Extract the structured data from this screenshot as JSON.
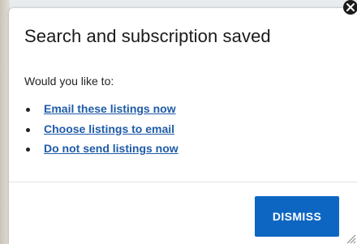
{
  "dialog": {
    "title": "Search and subscription saved",
    "prompt": "Would you like to:",
    "options": [
      {
        "label": "Email these listings now"
      },
      {
        "label": "Choose listings to email"
      },
      {
        "label": "Do not send listings now"
      }
    ],
    "dismiss_label": "DISMISS",
    "close_icon": "close-icon",
    "resize_icon": "resize-grip-icon"
  },
  "colors": {
    "link": "#1f5ba8",
    "button": "#0d66c2",
    "button_text": "#ffffff",
    "title": "#1a1a1a"
  }
}
